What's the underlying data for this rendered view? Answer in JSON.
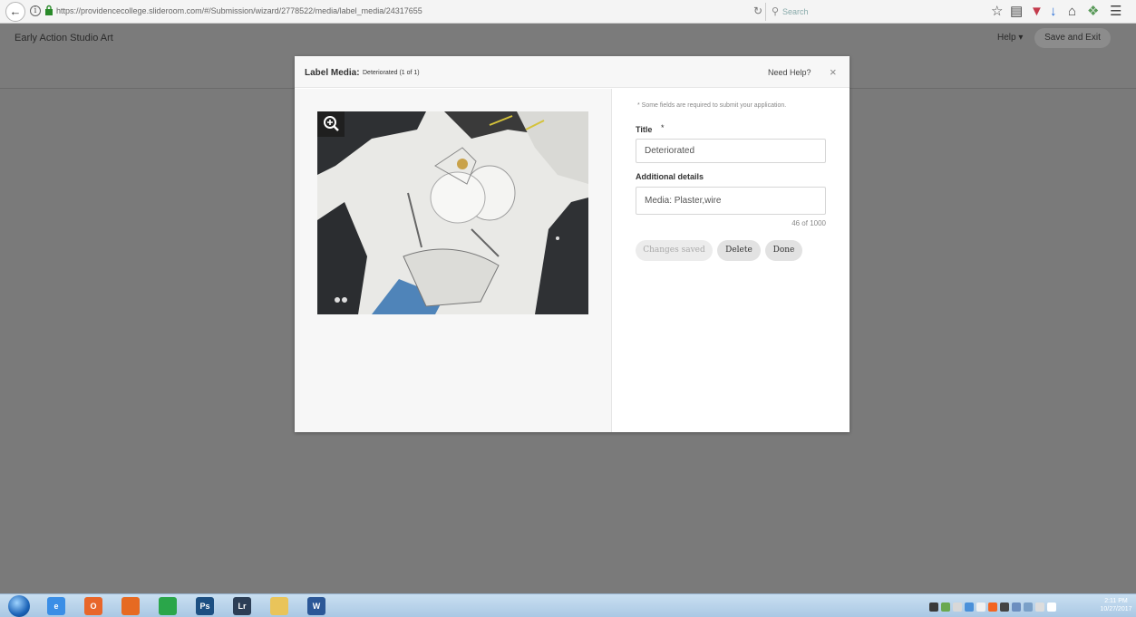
{
  "browser": {
    "url": "https://providencecollege.slideroom.com/#/Submission/wizard/2778522/media/label_media/24317655",
    "search_placeholder": "Search"
  },
  "app": {
    "title": "Early Action Studio Art",
    "help_label": "Help ▾",
    "save_exit_label": "Save and Exit"
  },
  "modal": {
    "title": "Label Media:",
    "subtitle": "Deteriorated (1 of 1)",
    "need_help": "Need Help?",
    "close_glyph": "×",
    "required_note": "* Some fields are required to submit your application.",
    "title_label": "Title",
    "required_star": "*",
    "title_value": "Deteriorated",
    "details_label": "Additional details",
    "details_value": "Media: Plaster,wire",
    "char_count": "46 of 1000",
    "buttons": {
      "changes_saved": "Changes saved",
      "delete": "Delete",
      "done": "Done"
    }
  },
  "taskbar": {
    "apps": [
      {
        "icon": "internet-explorer-icon",
        "label": "e",
        "color": "#3a8ee6"
      },
      {
        "icon": "office-icon",
        "label": "O",
        "color": "#e8662a"
      },
      {
        "icon": "firefox-icon",
        "label": "",
        "color": "#e66a22"
      },
      {
        "icon": "chrome-icon",
        "label": "",
        "color": "#2aa64a"
      },
      {
        "icon": "photoshop-icon",
        "label": "Ps",
        "color": "#1c4f82"
      },
      {
        "icon": "lightroom-icon",
        "label": "Lr",
        "color": "#2c3e56"
      },
      {
        "icon": "file-explorer-icon",
        "label": "",
        "color": "#e9c45a"
      },
      {
        "icon": "word-icon",
        "label": "W",
        "color": "#2b5797"
      }
    ],
    "time": "2:11 PM",
    "date": "10/27/2017"
  },
  "colors": {
    "overlay": "#7a7a7a",
    "modal_bg": "#ffffff",
    "left_pane_bg": "#f7f7f7"
  }
}
